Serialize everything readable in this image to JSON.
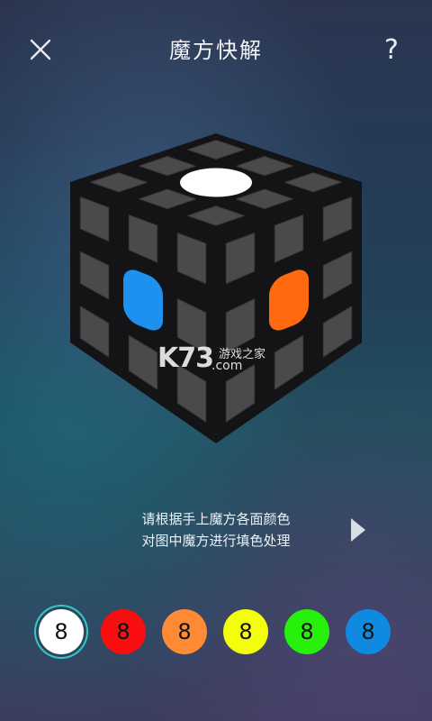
{
  "header": {
    "title": "魔方快解",
    "help_label": "?"
  },
  "icons": {
    "close": "close-icon",
    "next": "chevron-right-icon"
  },
  "cube": {
    "top_center_color": "#ffffff",
    "left_center_color": "#1e90ef",
    "right_center_color": "#ff6a10",
    "unfilled_color": "#4a4a4c"
  },
  "watermark": {
    "brand": "K73",
    "site_cn": "游戏之家",
    "domain": ".com"
  },
  "instruction": {
    "line1": "请根据手上魔方各面颜色",
    "line2": "对图中魔方进行填色处理"
  },
  "palette": [
    {
      "label": "8",
      "color": "#ffffff",
      "selected": true
    },
    {
      "label": "8",
      "color": "#f80e0e",
      "selected": false
    },
    {
      "label": "8",
      "color": "#ff8a35",
      "selected": false
    },
    {
      "label": "8",
      "color": "#f4fd0b",
      "selected": false
    },
    {
      "label": "8",
      "color": "#26f00c",
      "selected": false
    },
    {
      "label": "8",
      "color": "#0f8ae0",
      "selected": false
    }
  ]
}
